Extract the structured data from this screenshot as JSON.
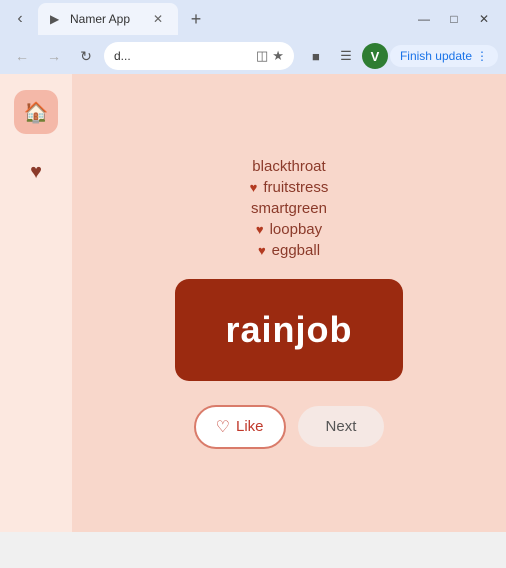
{
  "browser": {
    "tab_title": "Namer App",
    "address": "d...",
    "finish_update_label": "Finish update",
    "new_tab_symbol": "+",
    "back_symbol": "‹",
    "forward_symbol": "›",
    "reload_symbol": "↻",
    "close_symbol": "✕",
    "minimize_symbol": "—",
    "maximize_symbol": "□",
    "profile_letter": "V"
  },
  "sidebar": {
    "items": [
      {
        "id": "home",
        "icon": "🏠",
        "active": true
      },
      {
        "id": "heart",
        "icon": "♥",
        "active": false
      }
    ]
  },
  "content": {
    "names": [
      {
        "id": "blackthroat",
        "label": "blackthroat",
        "liked": false
      },
      {
        "id": "fruitstress",
        "label": "fruitstress",
        "liked": true
      },
      {
        "id": "smartgreen",
        "label": "smartgreen",
        "liked": false
      },
      {
        "id": "loopbay",
        "label": "loopbay",
        "liked": true
      },
      {
        "id": "eggball",
        "label": "eggball",
        "liked": true
      }
    ],
    "featured_name_part1": "rain",
    "featured_name_part2": "job",
    "like_button_label": "Like",
    "next_button_label": "Next",
    "heart_symbol": "♥"
  },
  "colors": {
    "accent": "#9b2a10",
    "sidebar_bg": "#fce8e0",
    "content_bg": "#f8d7cb",
    "text_color": "#8b3a2a",
    "heart_color": "#b33a20"
  }
}
